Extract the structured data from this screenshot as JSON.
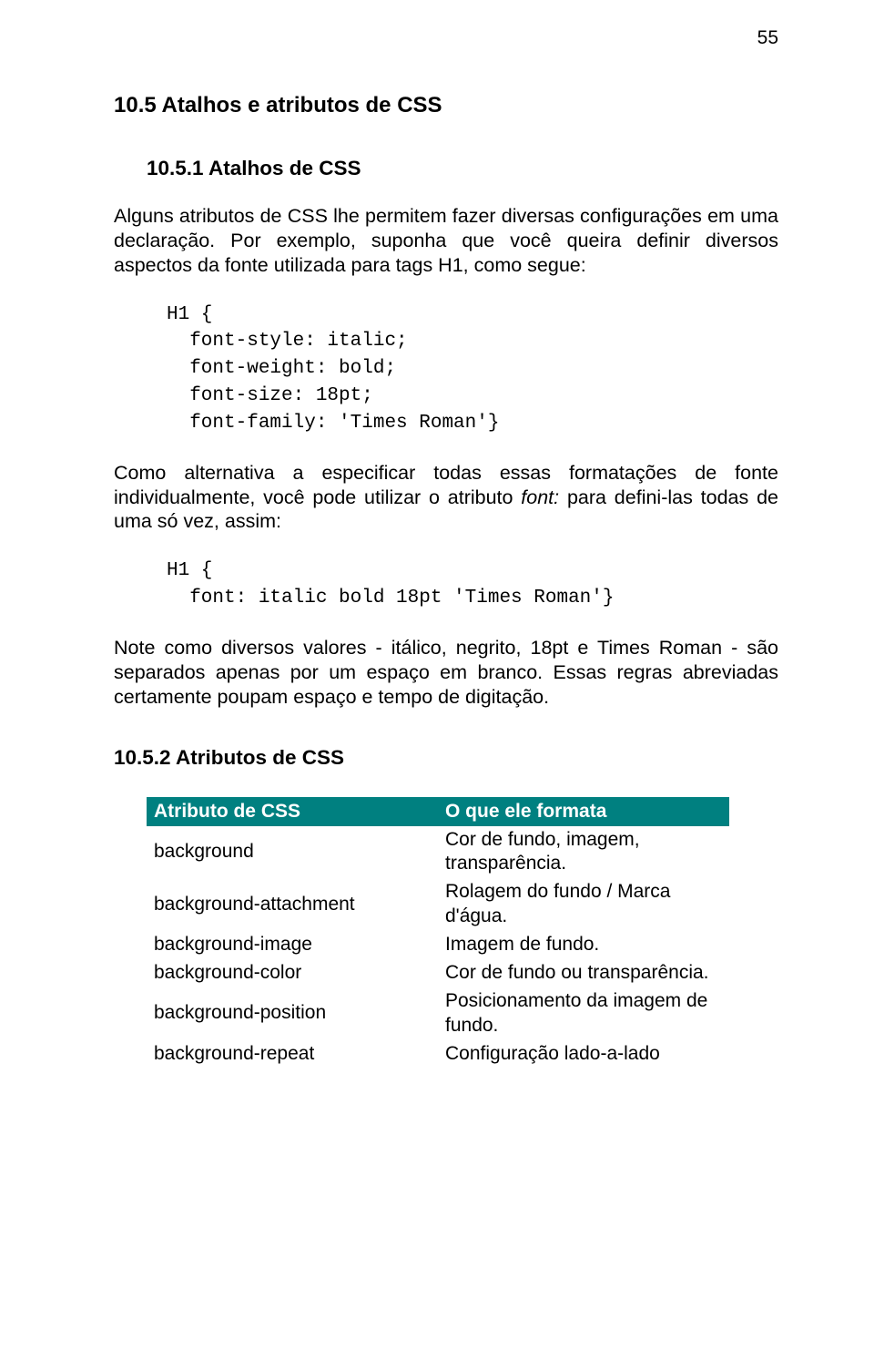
{
  "page_number": "55",
  "h2": "10.5 Atalhos e atributos de CSS",
  "h3_1": "10.5.1 Atalhos de CSS",
  "p1": "Alguns atributos de CSS lhe permitem fazer diversas configurações em uma declaração. Por exemplo, suponha que você queira definir diversos aspectos da fonte utilizada para tags H1, como segue:",
  "code1": "H1 {\n  font-style: italic;\n  font-weight: bold;\n  font-size: 18pt;\n  font-family: 'Times Roman'}",
  "p2a": "Como alternativa a especificar todas essas formatações de fonte individualmente, você pode utilizar o atributo ",
  "p2b": "font:",
  "p2c": " para defini-las todas de uma só vez, assim:",
  "code2": "H1 {\n  font: italic bold 18pt 'Times Roman'}",
  "p3": "Note como diversos valores - itálico, negrito, 18pt e Times Roman - são separados apenas por um espaço em branco. Essas regras abreviadas certamente poupam espaço e tempo de digitação.",
  "h3_2": "10.5.2 Atributos de CSS",
  "table": {
    "header": {
      "c1": "Atributo de CSS",
      "c2": "O que ele formata"
    },
    "rows": [
      {
        "c1": "background",
        "c2": "Cor de fundo, imagem, transparência."
      },
      {
        "c1": "background-attachment",
        "c2": "Rolagem do fundo / Marca d'água."
      },
      {
        "c1": "background-image",
        "c2": "Imagem de fundo."
      },
      {
        "c1": "background-color",
        "c2": "Cor de fundo ou transparência."
      },
      {
        "c1": "background-position",
        "c2": "Posicionamento da imagem de fundo."
      },
      {
        "c1": "background-repeat",
        "c2": "Configuração lado-a-lado"
      }
    ]
  }
}
